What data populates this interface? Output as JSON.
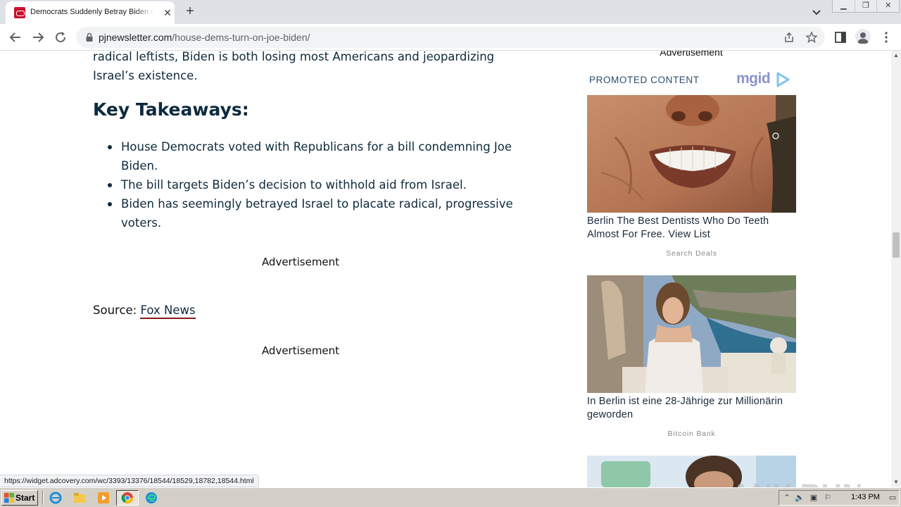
{
  "browser": {
    "tab": {
      "title": "Democrats Suddenly Betray Biden over",
      "close_glyph": "✕"
    },
    "new_tab_glyph": "+",
    "url": {
      "domain": "pjnewsletter.com",
      "path": "/house-dems-turn-on-joe-biden/"
    },
    "status_url": "https://widget.adcovery.com/wc/3393/13376/18544/18529,18782,18544.html"
  },
  "article": {
    "intro": "radical leftists, Biden is both losing most Americans and jeopardizing Israel’s existence.",
    "takeaways_title": "Key Takeaways:",
    "takeaways": [
      "House Democrats voted with Republicans for a bill condemning Joe Biden.",
      "The bill targets Biden’s decision to withhold aid from Israel.",
      "Biden has seemingly betrayed Israel to placate radical, progressive voters."
    ],
    "ad_label_1": "Advertisement",
    "source_label": "Source:",
    "source_link": "Fox News",
    "ad_label_2": "Advertisement"
  },
  "sidebar": {
    "ad_label": "Advertisement",
    "promoted": "PROMOTED CONTENT",
    "brand": "mgid",
    "cards": [
      {
        "title": "Berlin The Best Dentists Who Do Teeth Almost For Free. View List",
        "source": "Search Deals"
      },
      {
        "title": "In Berlin ist eine 28-Jährige zur Millionärin geworden",
        "source": "Bitcoin Bank"
      }
    ]
  },
  "watermark": "ANY RUN",
  "taskbar": {
    "start_label": "Start",
    "clock": "1:43 PM"
  },
  "colors": {
    "article_text": "#0e2a3c",
    "source_underline": "#8b1a1a",
    "mgid_brand": "#8a95c9",
    "favicon": "#c8102e"
  }
}
